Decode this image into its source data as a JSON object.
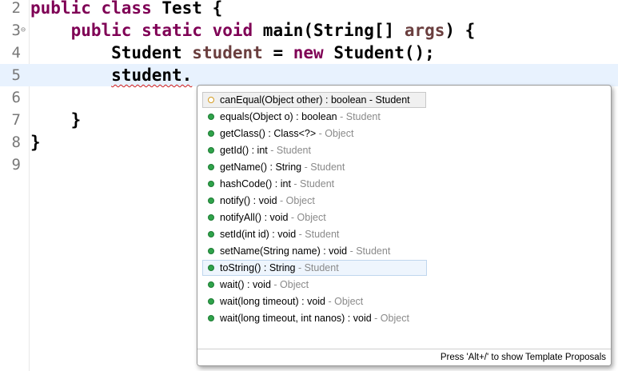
{
  "editor": {
    "lines": [
      {
        "num": "2",
        "fold": "",
        "parts": [
          {
            "t": "public class",
            "c": "kw"
          },
          {
            "t": " Test {",
            "c": ""
          }
        ]
      },
      {
        "num": "3",
        "fold": "⊖",
        "parts": [
          {
            "t": "    ",
            "c": ""
          },
          {
            "t": "public static void",
            "c": "kw"
          },
          {
            "t": " main(String[] ",
            "c": ""
          },
          {
            "t": "args",
            "c": "var"
          },
          {
            "t": ") {",
            "c": ""
          }
        ]
      },
      {
        "num": "4",
        "fold": "",
        "parts": [
          {
            "t": "        Student ",
            "c": ""
          },
          {
            "t": "student",
            "c": "var"
          },
          {
            "t": " = ",
            "c": ""
          },
          {
            "t": "new",
            "c": "kw"
          },
          {
            "t": " Student();",
            "c": ""
          }
        ]
      },
      {
        "num": "5",
        "fold": "",
        "current": true,
        "parts": [
          {
            "t": "        ",
            "c": ""
          },
          {
            "t": "student.",
            "c": "squiggle"
          }
        ]
      },
      {
        "num": "6",
        "fold": "",
        "parts": []
      },
      {
        "num": "7",
        "fold": "",
        "parts": [
          {
            "t": "    }",
            "c": ""
          }
        ]
      },
      {
        "num": "8",
        "fold": "",
        "parts": [
          {
            "t": "}",
            "c": ""
          }
        ]
      },
      {
        "num": "9",
        "fold": "",
        "parts": []
      }
    ]
  },
  "content_assist": {
    "proposals": [
      {
        "sig": "canEqual(Object other) : boolean - Student",
        "decl": "",
        "icon": "protected-method-icon",
        "state": "selected"
      },
      {
        "sig": "equals(Object o) : boolean",
        "decl": " - Student",
        "icon": "public-method-icon",
        "state": ""
      },
      {
        "sig": "getClass() : Class<?>",
        "decl": " - Object",
        "icon": "public-method-icon",
        "state": ""
      },
      {
        "sig": "getId() : int",
        "decl": " - Student",
        "icon": "public-method-icon",
        "state": ""
      },
      {
        "sig": "getName() : String",
        "decl": " - Student",
        "icon": "public-method-icon",
        "state": ""
      },
      {
        "sig": "hashCode() : int",
        "decl": " - Student",
        "icon": "public-method-icon",
        "state": ""
      },
      {
        "sig": "notify() : void",
        "decl": " - Object",
        "icon": "public-method-icon",
        "state": ""
      },
      {
        "sig": "notifyAll() : void",
        "decl": " - Object",
        "icon": "public-method-icon",
        "state": ""
      },
      {
        "sig": "setId(int id) : void",
        "decl": " - Student",
        "icon": "public-method-icon",
        "state": ""
      },
      {
        "sig": "setName(String name) : void",
        "decl": " - Student",
        "icon": "public-method-icon",
        "state": ""
      },
      {
        "sig": "toString() : String",
        "decl": " - Student",
        "icon": "public-method-icon",
        "state": "hovered"
      },
      {
        "sig": "wait() : void",
        "decl": " - Object",
        "icon": "public-method-icon",
        "state": ""
      },
      {
        "sig": "wait(long timeout) : void",
        "decl": " - Object",
        "icon": "public-method-icon",
        "state": ""
      },
      {
        "sig": "wait(long timeout, int nanos) : void",
        "decl": " - Object",
        "icon": "public-method-icon",
        "state": ""
      }
    ],
    "footer": "Press 'Alt+/' to show Template Proposals"
  },
  "colors": {
    "keyword": "#7f0055",
    "variable": "#6a3e3e",
    "current_line": "#e8f2fe",
    "method_dot": "#2fa34a",
    "protected_dot": "#d49a1e"
  }
}
